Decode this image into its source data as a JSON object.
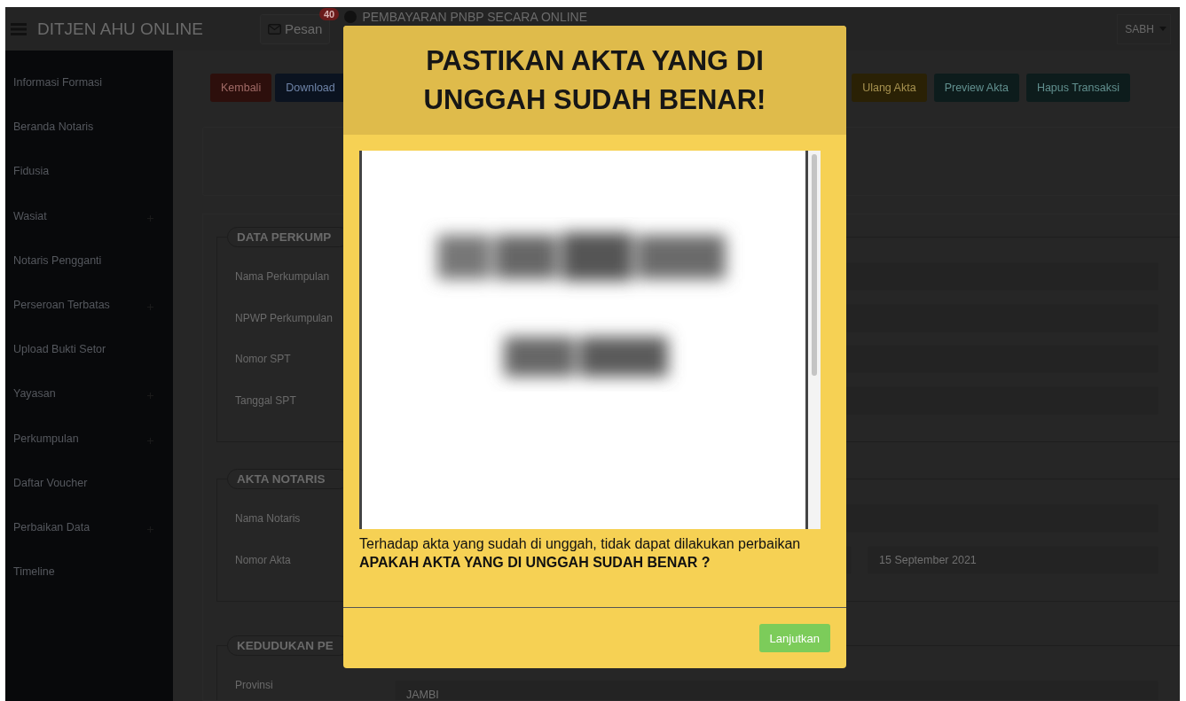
{
  "navbar": {
    "title": "DITJEN AHU ONLINE",
    "messages": {
      "label": "Pesan",
      "count": "40"
    },
    "payment_link": "PEMBAYARAN PNBP SECARA ONLINE",
    "user": "SABH"
  },
  "sidebar": {
    "items": [
      {
        "label": "Informasi Formasi",
        "expandable": false
      },
      {
        "label": "Beranda Notaris",
        "expandable": false
      },
      {
        "label": "Fidusia",
        "expandable": false
      },
      {
        "label": "Wasiat",
        "expandable": true
      },
      {
        "label": "Notaris Pengganti",
        "expandable": false
      },
      {
        "label": "Perseroan Terbatas",
        "expandable": true
      },
      {
        "label": "Upload Bukti Setor",
        "expandable": false
      },
      {
        "label": "Yayasan",
        "expandable": true
      },
      {
        "label": "Perkumpulan",
        "expandable": true
      },
      {
        "label": "Daftar Voucher",
        "expandable": false
      },
      {
        "label": "Perbaikan Data",
        "expandable": true
      },
      {
        "label": "Timeline",
        "expandable": false
      }
    ]
  },
  "actions_left": [
    {
      "label": "Kembali",
      "kind": "danger"
    },
    {
      "label": "Download",
      "kind": "primary"
    }
  ],
  "actions_right": [
    {
      "label": "Ulang Akta",
      "kind": "warning"
    },
    {
      "label": "Preview Akta",
      "kind": "info"
    },
    {
      "label": "Hapus Transaksi",
      "kind": "info"
    }
  ],
  "sections": [
    {
      "legend": "DATA PERKUMP",
      "fields": [
        {
          "label": "Nama Perkumpulan"
        },
        {
          "label": "NPWP Perkumpulan"
        },
        {
          "label": "Nomor SPT"
        },
        {
          "label": "Tanggal SPT"
        }
      ]
    },
    {
      "legend": "AKTA NOTARIS",
      "fields": [
        {
          "label": "Nama Notaris"
        },
        {
          "label": "Nomor Akta",
          "date": "15 September 2021"
        }
      ]
    },
    {
      "legend": "KEDUDUKAN PE",
      "fields": [
        {
          "label": "Provinsi",
          "value": "JAMBI"
        }
      ]
    }
  ],
  "modal": {
    "title": "PASTIKAN AKTA YANG DI UNGGAH SUDAH BENAR!",
    "message": "Terhadap akta yang sudah di unggah, tidak dapat dilakukan perbaikan",
    "question": "APAKAH AKTA YANG DI UNGGAH SUDAH BENAR ?",
    "button": "Lanjutkan"
  }
}
